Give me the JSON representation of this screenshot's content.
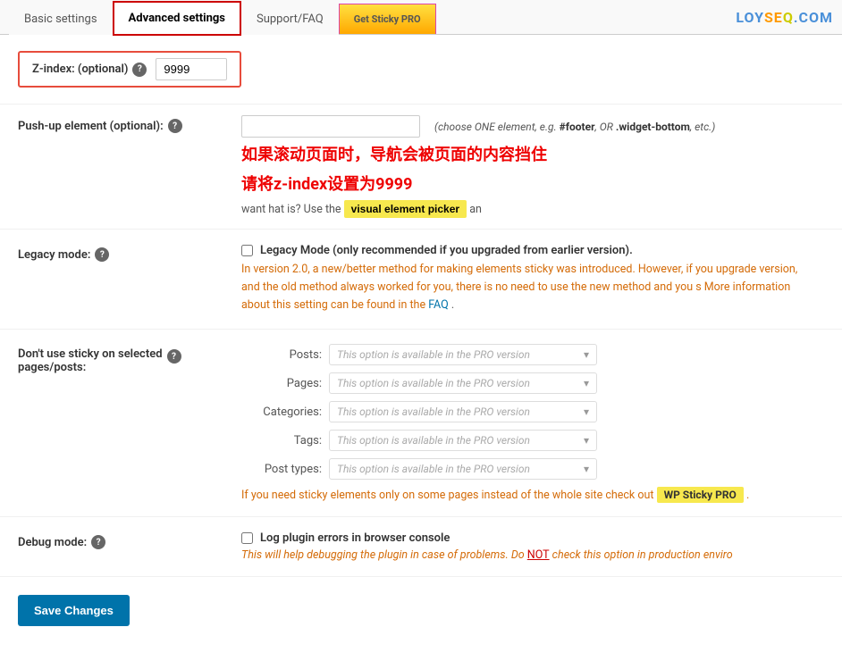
{
  "tabs": {
    "items": [
      {
        "id": "basic",
        "label": "Basic settings",
        "active": false,
        "highlight": false
      },
      {
        "id": "advanced",
        "label": "Advanced settings",
        "active": true,
        "highlight": true
      },
      {
        "id": "support",
        "label": "Support/FAQ",
        "active": false,
        "highlight": false
      },
      {
        "id": "get-pro",
        "label": "Get Sticky PRO",
        "active": false,
        "highlight": false,
        "pro": true
      }
    ],
    "logo": "LOYSEQ.COM"
  },
  "zindex": {
    "label": "Z-index: (optional)",
    "value": "9999"
  },
  "pushup": {
    "label": "Push-up element (optional):",
    "placeholder": "",
    "hint": "(choose ONE element, e.g.",
    "hint_code1": "#footer",
    "hint_or": "OR",
    "hint_code2": ".widget-bottom",
    "hint_etc": "etc.)"
  },
  "chinese_text": {
    "line1": "如果滚动页面时，导航会被页面的内容挡住",
    "line2": "请将z-index设置为9999"
  },
  "pushup_extra": {
    "prefix": "want",
    "question": "hat is? Use the",
    "picker_label": "visual element picker",
    "suffix": "an"
  },
  "legacy": {
    "label": "Legacy mode:",
    "checkbox_label": "Legacy Mode (only recommended if you upgraded from earlier version).",
    "desc_orange": "In version 2.0, a new/better method for making elements sticky was introduced. However, if you upgrade version, and the old method always worked for you, there is no need to use the new method and you s More information about this setting can be found in the",
    "faq_link": "FAQ",
    "faq_suffix": "."
  },
  "sticky_pages": {
    "label": "Don't use sticky on selected pages/posts:",
    "rows": [
      {
        "sublabel": "Posts:",
        "value": "This option is available in the PRO version"
      },
      {
        "sublabel": "Pages:",
        "value": "This option is available in the PRO version"
      },
      {
        "sublabel": "Categories:",
        "value": "This option is available in the PRO version"
      },
      {
        "sublabel": "Tags:",
        "value": "This option is available in the PRO version"
      },
      {
        "sublabel": "Post types:",
        "value": "This option is available in the PRO version"
      }
    ],
    "pro_note": "If you need sticky elements only on some pages instead of the whole site check out",
    "pro_badge": "WP Sticky PRO",
    "pro_suffix": "."
  },
  "debug": {
    "label": "Debug mode:",
    "checkbox_label": "Log plugin errors in browser console",
    "desc": "This will help debugging the plugin in case of problems. Do NOT check this option in production enviro"
  },
  "save_button": "Save Changes"
}
